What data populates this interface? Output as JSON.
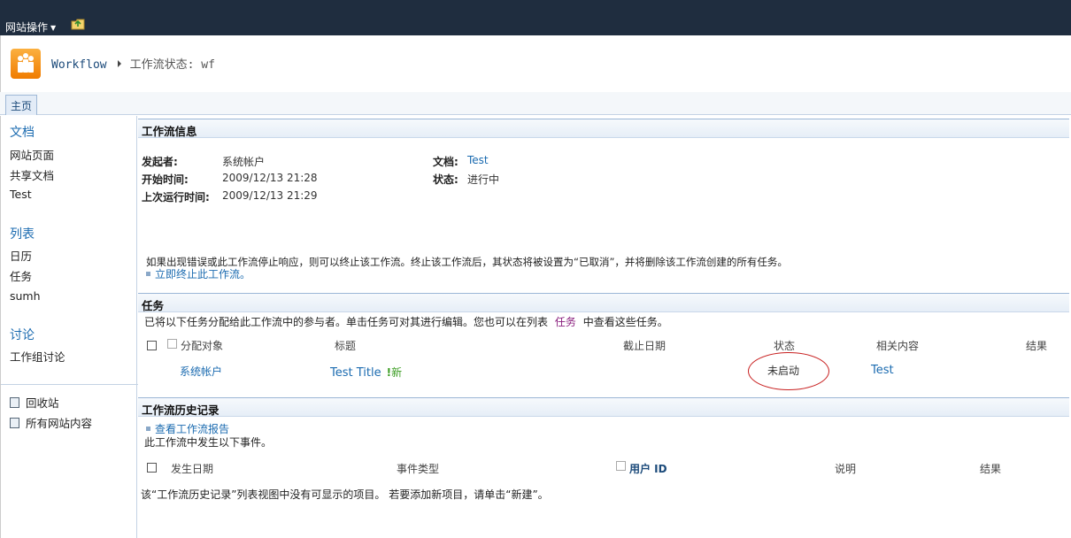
{
  "topbar": {
    "site_actions": "网站操作"
  },
  "breadcrumb": {
    "site": "Workflow",
    "page": "工作流状态: wf"
  },
  "tabs": {
    "home": "主页"
  },
  "quicklaunch": {
    "documents_heading": "文档",
    "documents": [
      "网站页面",
      "共享文档",
      "Test"
    ],
    "lists_heading": "列表",
    "lists": [
      "日历",
      "任务",
      "sumh"
    ],
    "discussions_heading": "讨论",
    "discussions": [
      "工作组讨论"
    ],
    "recycle_bin": "回收站",
    "all_content": "所有网站内容"
  },
  "workflow_info": {
    "header": "工作流信息",
    "initiator_label": "发起者:",
    "initiator": "系统帐户",
    "started_label": "开始时间:",
    "started": "2009/12/13 21:28",
    "last_run_label": "上次运行时间:",
    "last_run": "2009/12/13 21:29",
    "document_label": "文档:",
    "document": "Test",
    "status_label": "状态:",
    "status": "进行中",
    "terminate_note": "如果出现错误或此工作流停止响应，则可以终止该工作流。终止该工作流后，其状态将被设置为“已取消”，并将删除该工作流创建的所有任务。",
    "terminate_link": "立即终止此工作流。"
  },
  "tasks": {
    "header": "任务",
    "intro_before": "已将以下任务分配给此工作流中的参与者。单击任务可对其进行编辑。您也可以在列表",
    "intro_link": "任务",
    "intro_after": "中查看这些任务。",
    "columns": {
      "assigned_to": "分配对象",
      "title": "标题",
      "due_date": "截止日期",
      "status": "状态",
      "related": "相关内容",
      "outcome": "结果"
    },
    "rows": [
      {
        "assigned_to": "系统帐户",
        "title": "Test Title",
        "new_badge": "新",
        "due_date": "",
        "status": "未启动",
        "related": "Test",
        "outcome": ""
      }
    ]
  },
  "history": {
    "header": "工作流历史记录",
    "report_link": "查看工作流报告",
    "intro": "此工作流中发生以下事件。",
    "columns": {
      "date": "发生日期",
      "event_type": "事件类型",
      "user_id": "用户 ID",
      "description": "说明",
      "outcome": "结果"
    },
    "empty_message": "该“工作流历史记录”列表视图中没有可显示的项目。 若要添加新项目，请单击“新建”。"
  },
  "colors": {
    "topbar": "#1f2d3f",
    "link": "#1b6bb0",
    "annotation": "#c82020",
    "new_badge": "#3c9d23"
  }
}
